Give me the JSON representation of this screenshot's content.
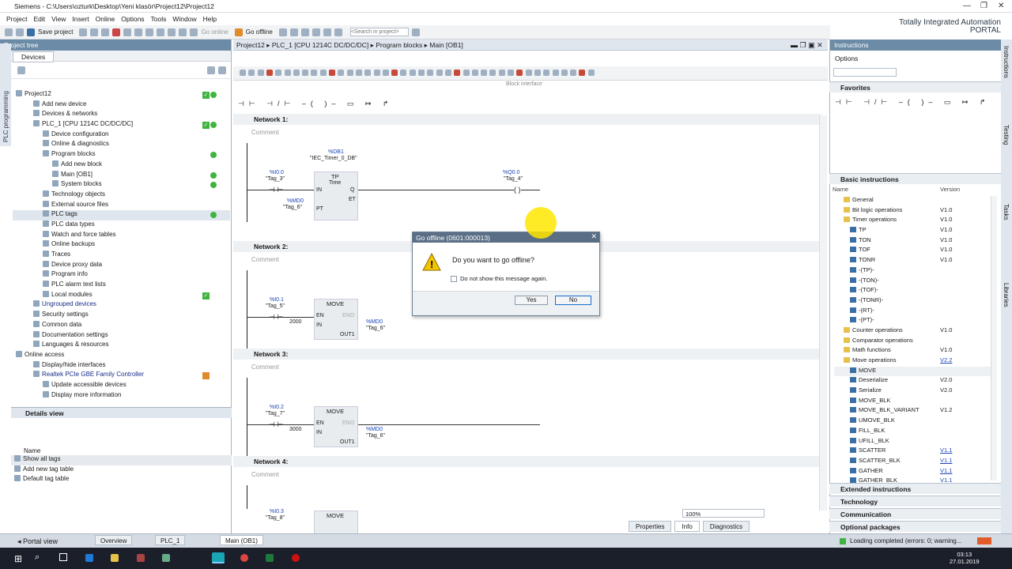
{
  "window": {
    "title": "Siemens - C:\\Users\\ozturk\\Desktop\\Yeni klasör\\Project12\\Project12",
    "brand1": "Totally Integrated Automation",
    "brand2": "PORTAL"
  },
  "menu": [
    "Project",
    "Edit",
    "View",
    "Insert",
    "Online",
    "Options",
    "Tools",
    "Window",
    "Help"
  ],
  "toolbar": {
    "save": "Save project",
    "go_online": "Go online",
    "go_offline": "Go offline",
    "search_placeholder": "<Search in project>"
  },
  "left": {
    "header": "Project tree",
    "tab": "Devices",
    "vertical_tab": "PLC programming",
    "tree": [
      {
        "label": "Project12",
        "indent": 0
      },
      {
        "label": "Add new device",
        "indent": 1
      },
      {
        "label": "Devices & networks",
        "indent": 1
      },
      {
        "label": "PLC_1 [CPU 1214C DC/DC/DC]",
        "indent": 1
      },
      {
        "label": "Device configuration",
        "indent": 2
      },
      {
        "label": "Online & diagnostics",
        "indent": 2
      },
      {
        "label": "Program blocks",
        "indent": 2
      },
      {
        "label": "Add new block",
        "indent": 3
      },
      {
        "label": "Main [OB1]",
        "indent": 3
      },
      {
        "label": "System blocks",
        "indent": 3
      },
      {
        "label": "Technology objects",
        "indent": 2
      },
      {
        "label": "External source files",
        "indent": 2
      },
      {
        "label": "PLC tags",
        "indent": 2
      },
      {
        "label": "PLC data types",
        "indent": 2
      },
      {
        "label": "Watch and force tables",
        "indent": 2
      },
      {
        "label": "Online backups",
        "indent": 2
      },
      {
        "label": "Traces",
        "indent": 2
      },
      {
        "label": "Device proxy data",
        "indent": 2
      },
      {
        "label": "Program info",
        "indent": 2
      },
      {
        "label": "PLC alarm text lists",
        "indent": 2
      },
      {
        "label": "Local modules",
        "indent": 2
      },
      {
        "label": "Ungrouped devices",
        "indent": 1
      },
      {
        "label": "Security settings",
        "indent": 1
      },
      {
        "label": "Common data",
        "indent": 1
      },
      {
        "label": "Documentation settings",
        "indent": 1
      },
      {
        "label": "Languages & resources",
        "indent": 1
      },
      {
        "label": "Online access",
        "indent": 0
      },
      {
        "label": "Display/hide interfaces",
        "indent": 1
      },
      {
        "label": "Realtek PCIe GBE Family Controller",
        "indent": 1
      },
      {
        "label": "Update accessible devices",
        "indent": 2
      },
      {
        "label": "Display more information",
        "indent": 2
      }
    ],
    "details_header": "Details view",
    "details_col": "Name",
    "details_rows": [
      "Show all tags",
      "Add new tag table",
      "Default tag table"
    ]
  },
  "editor": {
    "breadcrumb": "Project12 ▸ PLC_1 [CPU 1214C DC/DC/DC] ▸ Program blocks ▸ Main [OB1]",
    "block_interface": "Block interface",
    "comment": "Comment",
    "networks": [
      {
        "title": "Network 1:",
        "contact_addr": "%I0.0",
        "contact_tag": "\"Tag_3\"",
        "db_addr": "%DB1",
        "db_name": "\"IEC_Timer_0_DB\"",
        "box_title": "TP",
        "box_sub": "Time",
        "pin_in": "IN",
        "pin_q": "Q",
        "pin_et": "ET",
        "pin_pt": "PT",
        "pt_addr": "%MD0",
        "pt_tag": "\"Tag_6\"",
        "coil_addr": "%Q0.0",
        "coil_tag": "\"Tag_4\""
      },
      {
        "title": "Network 2:",
        "contact_addr": "%I0.1",
        "contact_tag": "\"Tag_5\"",
        "box_title": "MOVE",
        "en": "EN",
        "eno": "ENO",
        "in_val": "2000",
        "in": "IN",
        "out": "OUT1",
        "out_addr": "%MD0",
        "out_tag": "\"Tag_6\""
      },
      {
        "title": "Network 3:",
        "contact_addr": "%I0.2",
        "contact_tag": "\"Tag_7\"",
        "box_title": "MOVE",
        "en": "EN",
        "eno": "ENO",
        "in_val": "3000",
        "in": "IN",
        "out": "OUT1",
        "out_addr": "%MD0",
        "out_tag": "\"Tag_6\""
      },
      {
        "title": "Network 4:",
        "contact_addr": "%I0.3",
        "contact_tag": "\"Tag_8\"",
        "box_title": "MOVE"
      }
    ],
    "zoom": "100%",
    "bottom_tabs": [
      "Properties",
      "Info",
      "Diagnostics"
    ]
  },
  "dialog": {
    "title": "Go offline (0601:000013)",
    "question": "Do you want to go offline?",
    "checkbox": "Do not show this message again.",
    "yes": "Yes",
    "no": "No"
  },
  "right": {
    "header": "Instructions",
    "options": "Options",
    "favorites": "Favorites",
    "basic": "Basic instructions",
    "col_name": "Name",
    "col_version": "Version",
    "items": [
      {
        "name": "General",
        "ver": ""
      },
      {
        "name": "Bit logic operations",
        "ver": "V1.0"
      },
      {
        "name": "Timer operations",
        "ver": "V1.0"
      },
      {
        "name": "TP",
        "ver": "V1.0"
      },
      {
        "name": "TON",
        "ver": "V1.0"
      },
      {
        "name": "TOF",
        "ver": "V1.0"
      },
      {
        "name": "TONR",
        "ver": "V1.0"
      },
      {
        "name": "-(TP)-",
        "ver": ""
      },
      {
        "name": "-(TON)-",
        "ver": ""
      },
      {
        "name": "-(TOF)-",
        "ver": ""
      },
      {
        "name": "-(TONR)-",
        "ver": ""
      },
      {
        "name": "-(RT)-",
        "ver": ""
      },
      {
        "name": "-(PT)-",
        "ver": ""
      },
      {
        "name": "Counter operations",
        "ver": "V1.0"
      },
      {
        "name": "Comparator operations",
        "ver": ""
      },
      {
        "name": "Math functions",
        "ver": "V1.0"
      },
      {
        "name": "Move operations",
        "ver": "V2.2"
      },
      {
        "name": "MOVE",
        "ver": ""
      },
      {
        "name": "Deserialize",
        "ver": "V2.0"
      },
      {
        "name": "Serialize",
        "ver": "V2.0"
      },
      {
        "name": "MOVE_BLK",
        "ver": ""
      },
      {
        "name": "MOVE_BLK_VARIANT",
        "ver": "V1.2"
      },
      {
        "name": "UMOVE_BLK",
        "ver": ""
      },
      {
        "name": "FILL_BLK",
        "ver": ""
      },
      {
        "name": "UFILL_BLK",
        "ver": ""
      },
      {
        "name": "SCATTER",
        "ver": "V1.1"
      },
      {
        "name": "SCATTER_BLK",
        "ver": "V1.1"
      },
      {
        "name": "GATHER",
        "ver": "V1.1"
      },
      {
        "name": "GATHER_BLK",
        "ver": "V1.1"
      }
    ],
    "sections": [
      "Extended instructions",
      "Technology",
      "Communication",
      "Optional packages"
    ],
    "vtabs": [
      "Instructions",
      "Testing",
      "Tasks",
      "Libraries"
    ]
  },
  "status": {
    "portal": "Portal view",
    "tabs": [
      "Overview",
      "PLC_1",
      "Main (OB1)"
    ],
    "message": "Loading completed (errors: 0; warning..."
  },
  "clock": {
    "time": "03:13",
    "date": "27.01.2019"
  }
}
